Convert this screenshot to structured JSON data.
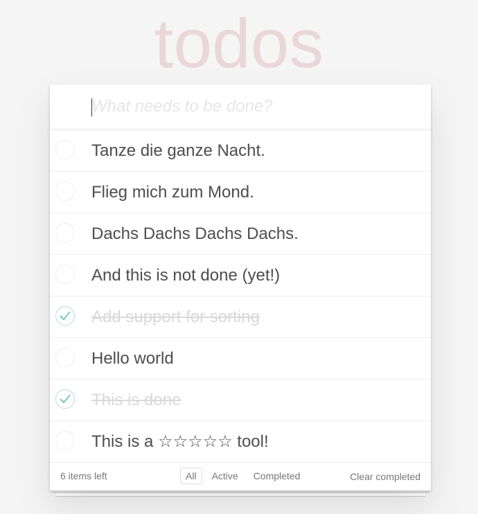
{
  "app": {
    "title": "todos"
  },
  "new_todo": {
    "placeholder": "What needs to be done?",
    "value": ""
  },
  "todos": [
    {
      "text": "Tanze die ganze Nacht.",
      "completed": false
    },
    {
      "text": "Flieg mich zum Mond.",
      "completed": false
    },
    {
      "text": "Dachs Dachs Dachs Dachs.",
      "completed": false
    },
    {
      "text": "And this is not done (yet!)",
      "completed": false
    },
    {
      "text": "Add support for sorting",
      "completed": true
    },
    {
      "text": "Hello world",
      "completed": false
    },
    {
      "text": "This is done",
      "completed": true
    },
    {
      "text": "This is a ☆☆☆☆☆ tool!",
      "completed": false
    }
  ],
  "footer": {
    "items_left": "6 items left",
    "filters": [
      {
        "label": "All",
        "selected": true
      },
      {
        "label": "Active",
        "selected": false
      },
      {
        "label": "Completed",
        "selected": false
      }
    ],
    "clear_completed_label": "Clear completed"
  },
  "colors": {
    "title": "#eaD7d7",
    "check": "#5dc2af",
    "completed_text": "#d9d9d9",
    "background": "#f5f5f5"
  }
}
